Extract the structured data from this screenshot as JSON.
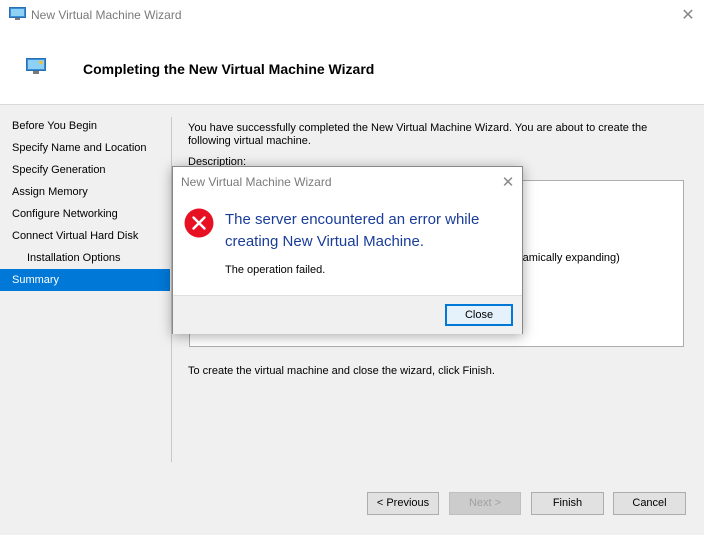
{
  "window": {
    "title": "New Virtual Machine Wizard",
    "close_glyph": "✕"
  },
  "header": {
    "title": "Completing the New Virtual Machine Wizard"
  },
  "nav": {
    "items": [
      {
        "label": "Before You Begin"
      },
      {
        "label": "Specify Name and Location"
      },
      {
        "label": "Specify Generation"
      },
      {
        "label": "Assign Memory"
      },
      {
        "label": "Configure Networking"
      },
      {
        "label": "Connect Virtual Hard Disk"
      },
      {
        "label": "Installation Options"
      },
      {
        "label": "Summary"
      }
    ],
    "selected": "Summary"
  },
  "main": {
    "intro": "You have successfully completed the New Virtual Machine Wizard. You are about to create the following virtual machine.",
    "description_label": "Description:",
    "description_fragment": "ynamically expanding)",
    "finish_text": "To create the virtual machine and close the wizard, click Finish."
  },
  "buttons": {
    "previous": "< Previous",
    "next": "Next >",
    "finish": "Finish",
    "cancel": "Cancel"
  },
  "dialog": {
    "title": "New Virtual Machine Wizard",
    "close_glyph": "✕",
    "message": "The server encountered an error while creating New Virtual Machine.",
    "detail": "The operation failed.",
    "close_button": "Close"
  },
  "colors": {
    "accent": "#0078d7",
    "error_red": "#e81123",
    "message_blue": "#1a3d99"
  }
}
